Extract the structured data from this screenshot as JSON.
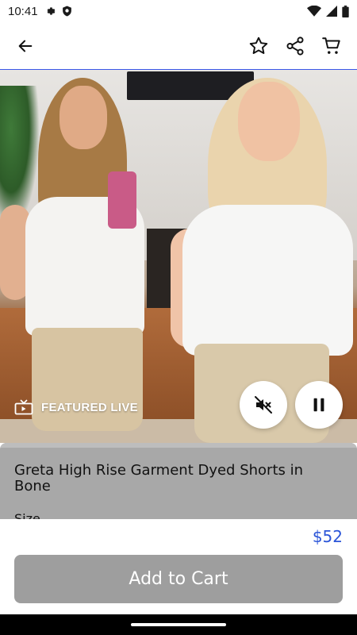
{
  "status_bar": {
    "time": "10:41",
    "icons_left": [
      "gear-icon",
      "shield-icon"
    ],
    "icons_right": [
      "wifi-icon",
      "signal-icon",
      "battery-icon"
    ]
  },
  "app_bar": {
    "back_icon": "arrow-left-icon",
    "actions": [
      "star-icon",
      "share-icon",
      "cart-icon"
    ],
    "accent_line_color": "#3a57e8"
  },
  "video": {
    "featured_label": "FEATURED LIVE",
    "featured_icon": "tv-icon",
    "mute_icon": "volume-off-icon",
    "pause_icon": "pause-icon"
  },
  "product": {
    "title": "Greta High Rise Garment Dyed Shorts in Bone",
    "size_label": "Size"
  },
  "purchase": {
    "price": "$52",
    "price_color": "#2b55d8",
    "add_to_cart_label": "Add to Cart",
    "button_color": "#9e9e9e"
  }
}
